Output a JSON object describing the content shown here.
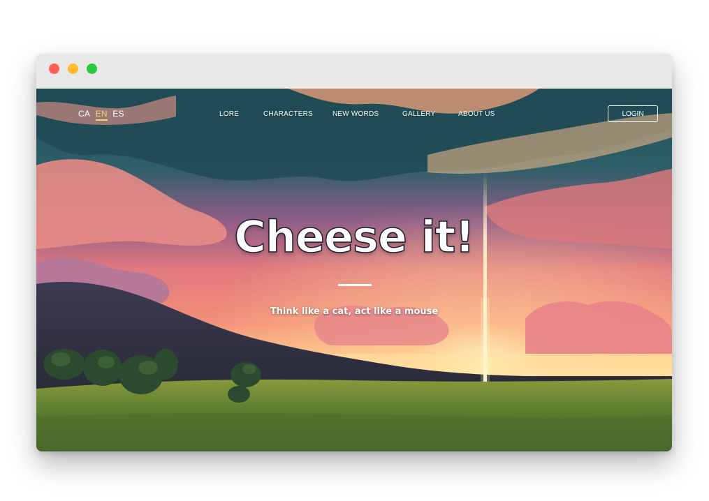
{
  "colors": {
    "close": "#ff5f57",
    "minimize": "#febc2e",
    "zoom": "#28c840",
    "accent": "#f6d86b"
  },
  "languages": {
    "ca": "CA",
    "en": "EN",
    "es": "ES",
    "active": "EN"
  },
  "nav": {
    "lore": "LORE",
    "characters": "CHARACTERS",
    "new_words": "NEW WORDS",
    "gallery": "GALLERY",
    "about_us": "ABOUT US"
  },
  "login_label": "LOGIN",
  "hero": {
    "title": "Cheese it!",
    "subtitle": "Think like a cat, act like a mouse"
  }
}
